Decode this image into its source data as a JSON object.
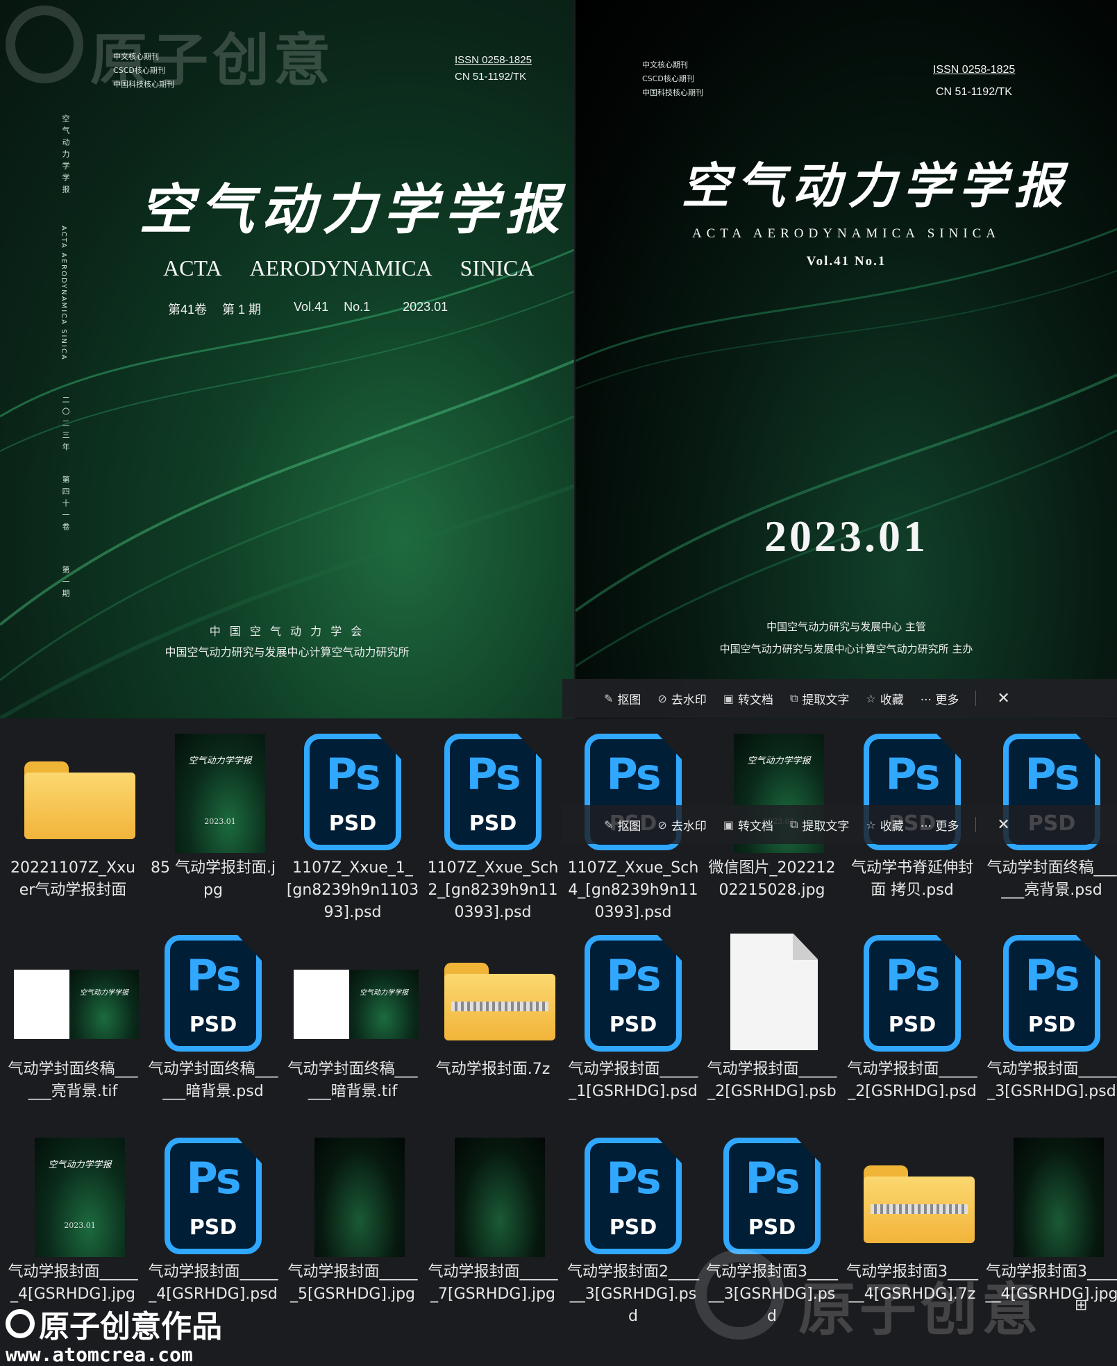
{
  "left_cover": {
    "watermark": "原子创意",
    "badges": [
      "中文核心期刊",
      "CSCD核心期刊",
      "中国科技核心期刊"
    ],
    "issn": "ISSN 0258-1825",
    "cn": "CN 51-1192/TK",
    "title_cn": "空气动力学学报",
    "title_en": [
      "ACTA",
      "AERODYNAMICA",
      "SINICA"
    ],
    "issue_cn_vol": "第41卷",
    "issue_cn_no": "第 1 期",
    "issue_vol": "Vol.41",
    "issue_no": "No.1",
    "issue_date": "2023.01",
    "spine_title": "空气动力学学报",
    "spine_en": "ACTA AERODYNAMICA SINICA",
    "spine_year": "二〇二三年",
    "spine_vol": "第四十一卷",
    "spine_no": "第一期",
    "publisher_1": "中 国 空 气 动 力 学 会",
    "publisher_2": "中国空气动力研究与发展中心计算空气动力研究所"
  },
  "right_cover": {
    "badges": [
      "中文核心期刊",
      "CSCD核心期刊",
      "中国科技核心期刊"
    ],
    "issn": "ISSN 0258-1825",
    "cn": "CN 51-1192/TK",
    "title_cn": "空气动力学学报",
    "title_en": "ACTA AERODYNAMICA SINICA",
    "vol_no": "Vol.41  No.1",
    "date": "2023.01",
    "sponsor_1": "中国空气动力研究与发展中心  主管",
    "sponsor_2": "中国空气动力研究与发展中心计算空气动力研究所    主办"
  },
  "toolbar": {
    "cutout": "抠图",
    "remove_watermark": "去水印",
    "convert_doc": "转文档",
    "extract_text": "提取文字",
    "favorite": "收藏",
    "more": "··· 更多",
    "close": "✕"
  },
  "files": [
    {
      "name": "20221107Z_Xxuer气动学报封面",
      "type": "folder"
    },
    {
      "name": "85 气动学报封面.jpg",
      "type": "cover"
    },
    {
      "name": "1107Z_Xxue_1_[gn8239h9n110393].psd",
      "type": "psd"
    },
    {
      "name": "1107Z_Xxue_Sch2_[gn8239h9n110393].psd",
      "type": "psd"
    },
    {
      "name": "1107Z_Xxue_Sch4_[gn8239h9n110393].psd",
      "type": "psd"
    },
    {
      "name": "微信图片_20221202215028.jpg",
      "type": "cover"
    },
    {
      "name": "气动学书脊延伸封面 拷贝.psd",
      "type": "psd"
    },
    {
      "name": "气动学封面终稿______亮背景.psd",
      "type": "psd"
    },
    {
      "name": "气动学封面终稿______亮背景.tif",
      "type": "wide"
    },
    {
      "name": "气动学封面终稿______暗背景.psd",
      "type": "psd"
    },
    {
      "name": "气动学封面终稿______暗背景.tif",
      "type": "wide"
    },
    {
      "name": "气动学报封面.7z",
      "type": "zip"
    },
    {
      "name": "气动学报封面______1[GSRHDG].psd",
      "type": "psd"
    },
    {
      "name": "气动学报封面______2[GSRHDG].psb",
      "type": "doc"
    },
    {
      "name": "气动学报封面______2[GSRHDG].psd",
      "type": "psd"
    },
    {
      "name": "气动学报封面______3[GSRHDG].psd",
      "type": "psd"
    },
    {
      "name": "气动学报封面______4[GSRHDG].jpg",
      "type": "cover"
    },
    {
      "name": "气动学报封面______4[GSRHDG].psd",
      "type": "psd"
    },
    {
      "name": "气动学报封面______5[GSRHDG].jpg",
      "type": "dark"
    },
    {
      "name": "气动学报封面______7[GSRHDG].jpg",
      "type": "dark"
    },
    {
      "name": "气动学报封面2______3[GSRHDG].psd",
      "type": "psd"
    },
    {
      "name": "气动学报封面3______3[GSRHDG].psd",
      "type": "psd"
    },
    {
      "name": "气动学报封面3______4[GSRHDG].7z",
      "type": "zip"
    },
    {
      "name": "气动学报封面3______4[GSRHDG].jpg",
      "type": "dark"
    }
  ],
  "icons": {
    "ps": "Ps",
    "psd": "PSD",
    "cover_thumb_title": "空气动力学学报",
    "cover_thumb_date": "2023.01"
  },
  "brand": {
    "name": "原子创意作品",
    "url": "www.atomcrea.com"
  },
  "colors": {
    "psd_blue": "#31a8ff",
    "psd_bg": "#001e36",
    "folder_yellow": "#f2b43a",
    "background": "#1b1c1f"
  }
}
